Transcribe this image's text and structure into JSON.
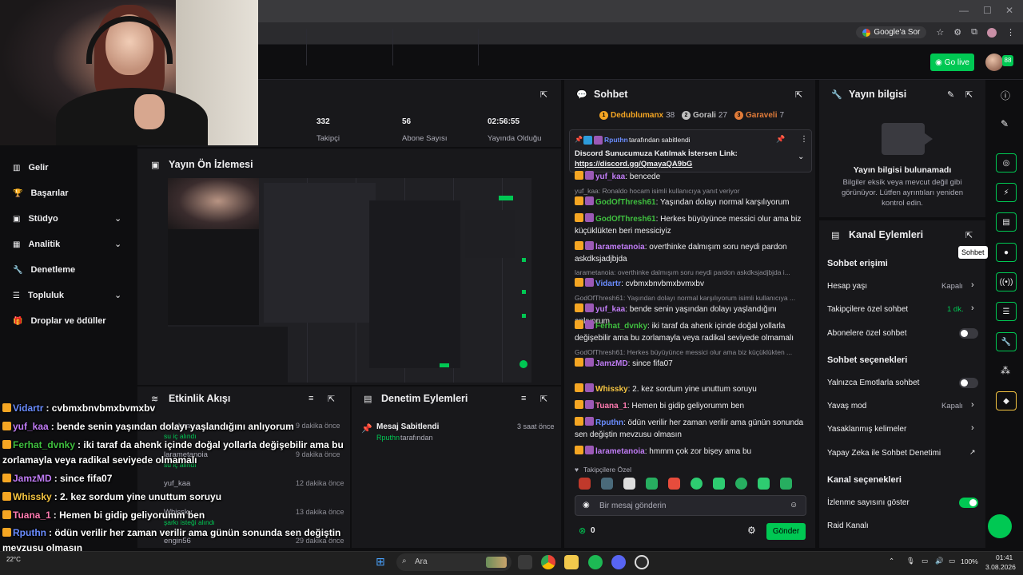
{
  "browser": {
    "google_ask": "Google'a Sor"
  },
  "header": {
    "go_live": "Go live",
    "badge": "88"
  },
  "sidebar": {
    "items": [
      {
        "label": "Gelir",
        "icon": "revenue-icon"
      },
      {
        "label": "Başarılar",
        "icon": "trophy-icon"
      },
      {
        "label": "Stüdyo",
        "icon": "studio-icon",
        "chevron": true
      },
      {
        "label": "Analitik",
        "icon": "analytics-icon",
        "chevron": true
      },
      {
        "label": "Denetleme",
        "icon": "wrench-icon"
      },
      {
        "label": "Topluluk",
        "icon": "community-icon",
        "chevron": true
      },
      {
        "label": "Droplar ve ödüller",
        "icon": "gift-icon"
      }
    ]
  },
  "stats": [
    {
      "value": "332",
      "label": "Takipçi"
    },
    {
      "value": "56",
      "label": "Abone Sayısı"
    },
    {
      "value": "02:56:55",
      "label": "Yayında Olduğu"
    }
  ],
  "preview": {
    "title": "Yayın Ön İzlemesi"
  },
  "activity": {
    "title": "Etkinlik Akışı",
    "rows": [
      {
        "user": "yuf_kaa",
        "time": "9 dakika önce",
        "sub": "su iç alındı"
      },
      {
        "user": "larametanoia",
        "time": "9 dakika önce",
        "sub": "su iç alındı"
      },
      {
        "user": "yuf_kaa",
        "time": "12 dakika önce",
        "sub": ""
      },
      {
        "user": "Whissky",
        "time": "13 dakika önce",
        "sub": "şarkı isteği alındı"
      },
      {
        "user": "engin56",
        "time": "29 dakika önce",
        "sub": ""
      }
    ]
  },
  "mod_actions": {
    "title": "Denetim Eylemleri",
    "item_title": "Mesaj Sabitlendi",
    "item_time": "3 saat önce",
    "item_user": "Rputhn",
    "item_suffix": "tarafından"
  },
  "chat": {
    "title": "Sohbet",
    "leaders": [
      {
        "name": "Dedublumanx",
        "count": "38",
        "color": "#f5a623"
      },
      {
        "name": "Gorali",
        "count": "27",
        "color": "#c0c0c0"
      },
      {
        "name": "Garaveli",
        "count": "7",
        "color": "#e07b39"
      }
    ],
    "pinned": {
      "by_user": "Rputhn",
      "by_suffix": "tarafından sabitlendi",
      "text": "Discord Sunucumuza Katılmak İstersen Link:",
      "link": "https://discord.gg/QmayaQA9bG"
    },
    "messages": [
      {
        "kind": "msg",
        "user": "yuf_kaa",
        "color": "#c07cf5",
        "text": ": bencede"
      },
      {
        "kind": "reply",
        "text": "yuf_kaa: Ronaldo hocam isimli kullanıcıya yanıt veriyor"
      },
      {
        "kind": "msg",
        "user": "GodOfThresh61",
        "color": "#3fbf3f",
        "text": ": Yaşından dolayı normal karşılıyorum"
      },
      {
        "kind": "msg",
        "user": "GodOfThresh61",
        "color": "#3fbf3f",
        "text": ": Herkes büyüyünce messici olur ama biz küçüklükten beri messiciyiz"
      },
      {
        "kind": "msg",
        "user": "larametanoia",
        "color": "#c07cf5",
        "text": ": overthinke dalmışım soru neydi pardon askdksjadjbjda"
      },
      {
        "kind": "reply",
        "text": "larametanoia: overthinke dalmışım soru neydi pardon askdksjadjbjda i..."
      },
      {
        "kind": "msg",
        "user": "Vidartr",
        "color": "#6a8cff",
        "text": ": cvbmxbnvbmxbvmxbv"
      },
      {
        "kind": "reply",
        "text": "GodOfThresh61: Yaşından dolayı normal karşılıyorum isimli kullanıcıya ..."
      },
      {
        "kind": "msg",
        "user": "yuf_kaa",
        "color": "#c07cf5",
        "text": ": bende senin yaşından dolayı yaşlandığını anlıyorum"
      },
      {
        "kind": "msg",
        "user": "Ferhat_dvnky",
        "color": "#3fbf3f",
        "text": ": iki taraf da ahenk içinde doğal yollarla değişebilir ama bu zorlamayla veya radikal seviyede olmamalı"
      },
      {
        "kind": "reply",
        "text": "GodOfThresh61: Herkes büyüyünce messici olur ama biz küçüklükten ..."
      },
      {
        "kind": "msg",
        "user": "JamzMD",
        "color": "#c07cf5",
        "text": ": since fifa07"
      },
      {
        "kind": "msg",
        "user": "Whissky",
        "color": "#f5c542",
        "text": ": 2. kez sordum yine unuttum soruyu"
      },
      {
        "kind": "msg",
        "user": "Tuana_1",
        "color": "#ff7ab0",
        "text": ": Hemen bi gidip geliyorumm ben"
      },
      {
        "kind": "msg",
        "user": "Rputhn",
        "color": "#6a8cff",
        "text": ": ödün verilir her zaman verilir ama günün sonunda sen değiştin mevzusu olmasın"
      },
      {
        "kind": "msg",
        "user": "larametanoia",
        "color": "#c07cf5",
        "text": ": hmmm çok zor bişey ama bu"
      }
    ],
    "followers_label": "Takipçilere Özel",
    "input_placeholder": "Bir mesaj gönderin",
    "points": "0",
    "send": "Gönder"
  },
  "stream_info": {
    "title": "Yayın bilgisi",
    "empty_title": "Yayın bilgisi bulunamadı",
    "empty_text": "Bilgiler eksik veya mevcut değil gibi görünüyor. Lütfen ayrıntıları yeniden kontrol edin."
  },
  "channel_actions": {
    "title": "Kanal Eylemleri",
    "sec1": "Sohbet erişimi",
    "account_age": "Hesap yaşı",
    "account_age_val": "Kapalı",
    "followers_only": "Takipçilere özel sohbet",
    "followers_only_val": "1 dk.",
    "subs_only": "Abonelere özel sohbet",
    "sec2": "Sohbet seçenekleri",
    "emote_only": "Yalnızca Emotlarla sohbet",
    "slow_mode": "Yavaş mod",
    "slow_mode_val": "Kapalı",
    "banned_words": "Yasaklanmış kelimeler",
    "ai_mod": "Yapay Zeka ile Sohbet Denetimi",
    "sec3": "Kanal seçenekleri",
    "show_viewers": "İzlenme sayısını göster",
    "raid": "Raid Kanalı"
  },
  "rail": {
    "tooltip": "Sohbet"
  },
  "overlay": [
    {
      "user": "Vidartr",
      "color": "#6a8cff",
      "text": ": cvbmxbnvbmxbvmxbv"
    },
    {
      "user": "yuf_kaa",
      "color": "#c07cf5",
      "text": ": bende senin yaşından dolayı yaşlandığını anlıyorum"
    },
    {
      "user": "Ferhat_dvnky",
      "color": "#3fbf3f",
      "text": ": iki taraf da ahenk içinde doğal yollarla değişebilir ama bu"
    },
    {
      "user": "",
      "color": "#fff",
      "text": "zorlamayla veya radikal seviyede olmamalı"
    },
    {
      "user": "JamzMD",
      "color": "#c07cf5",
      "text": ": since fifa07"
    },
    {
      "user": "Whissky",
      "color": "#f5c542",
      "text": ": 2. kez sordum yine unuttum soruyu"
    },
    {
      "user": "Tuana_1",
      "color": "#ff7ab0",
      "text": ": Hemen bi gidip geliyorumm ben"
    },
    {
      "user": "Rputhn",
      "color": "#6a8cff",
      "text": ": ödün verilir her zaman verilir ama günün sonunda sen değiştin"
    },
    {
      "user": "",
      "color": "#fff",
      "text": "mevzusu olmasın"
    },
    {
      "user": "larametanoia",
      "color": "#c07cf5",
      "text": ": hmmm çok zor bişey ama bu"
    }
  ],
  "taskbar": {
    "search": "Ara",
    "weather": "22°C",
    "battery": "100%",
    "time": "01:41",
    "date": "3.08.2026"
  },
  "colors": {
    "accent": "#00c853",
    "panel": "#18181b",
    "background": "#0e0e10"
  }
}
